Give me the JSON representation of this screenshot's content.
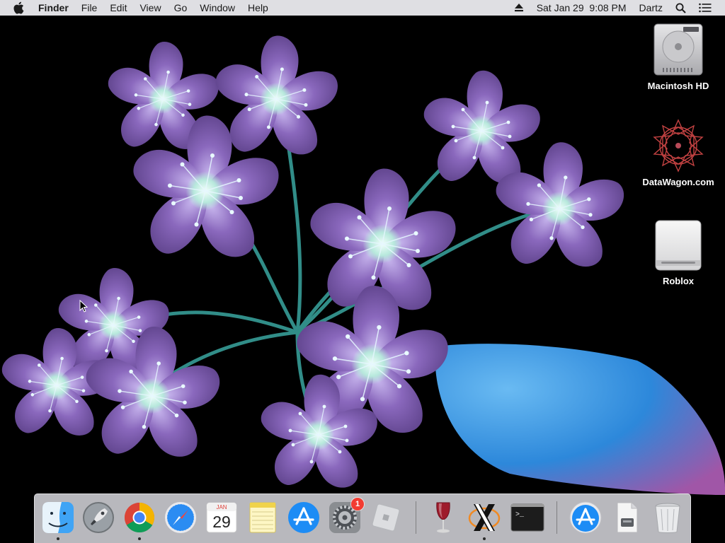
{
  "menubar": {
    "app_name": "Finder",
    "menus": [
      "File",
      "Edit",
      "View",
      "Go",
      "Window",
      "Help"
    ],
    "datetime": "Sat Jan 29  9:08 PM",
    "user": "Dartz",
    "icons": [
      "apple-logo-icon",
      "eject-icon",
      "search-icon",
      "notification-center-icon"
    ]
  },
  "desktop": {
    "icons": [
      {
        "label": "Macintosh HD",
        "icon": "hard-drive-icon"
      },
      {
        "label": "DataWagon.com",
        "icon": "datawagon-icon"
      },
      {
        "label": "Roblox",
        "icon": "external-drive-icon"
      }
    ]
  },
  "dock": {
    "apps": [
      {
        "name": "Finder",
        "icon": "finder-icon",
        "running": true
      },
      {
        "name": "Launchpad",
        "icon": "launchpad-icon",
        "running": false
      },
      {
        "name": "Google Chrome",
        "icon": "chrome-icon",
        "running": true
      },
      {
        "name": "Safari",
        "icon": "safari-icon",
        "running": false
      },
      {
        "name": "Calendar",
        "icon": "calendar-icon",
        "running": false,
        "month": "JAN",
        "day": "29"
      },
      {
        "name": "Notes",
        "icon": "notes-icon",
        "running": false
      },
      {
        "name": "App Store",
        "icon": "app-store-icon",
        "running": false
      },
      {
        "name": "System Preferences",
        "icon": "system-preferences-icon",
        "running": false,
        "badge": "1"
      },
      {
        "name": "Roblox",
        "icon": "roblox-icon",
        "running": false
      },
      {
        "name": "Wine",
        "icon": "wine-icon",
        "running": false
      },
      {
        "name": "XQuartz",
        "icon": "xquartz-icon",
        "running": true
      },
      {
        "name": "Terminal",
        "icon": "terminal-icon",
        "running": false,
        "prompt": ">_"
      },
      {
        "name": "Downloads",
        "icon": "downloads-stack-icon",
        "running": false
      },
      {
        "name": "Document",
        "icon": "document-stack-icon",
        "running": false
      },
      {
        "name": "Trash",
        "icon": "trash-icon",
        "running": false
      }
    ]
  },
  "colors": {
    "menubar_bg": "#e8e8ec",
    "dock_bg": "#e1e1e6",
    "badge": "#f23c32",
    "petal": "#7a5aa8",
    "leaf": "#3f9be8",
    "stem": "#3aa6a0"
  }
}
